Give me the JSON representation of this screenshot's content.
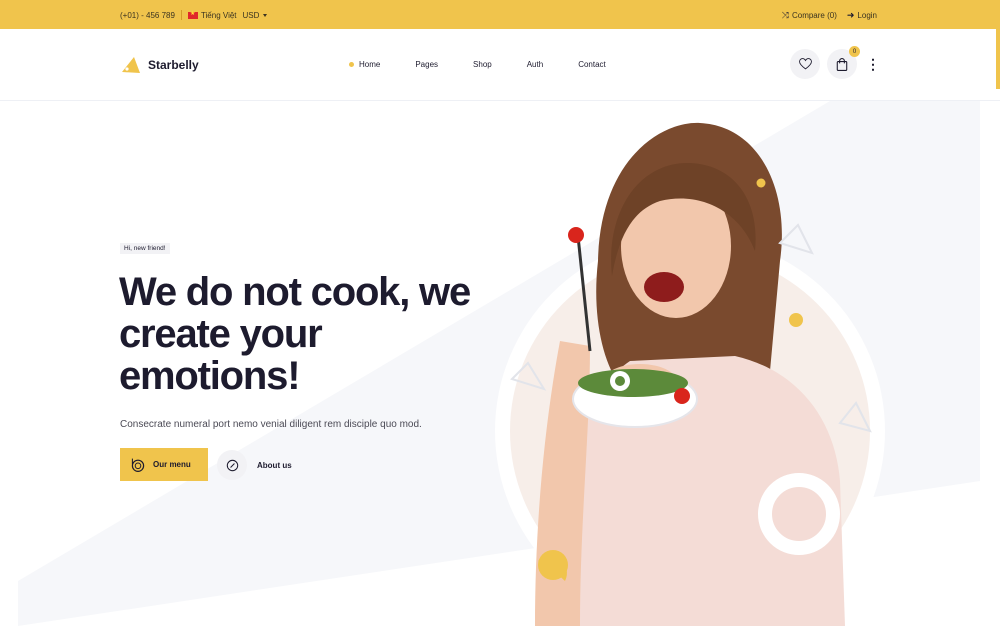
{
  "topbar": {
    "phone": "(+01) - 456 789",
    "language": "Tiếng Việt",
    "currency": "USD",
    "compare": "Compare (0)",
    "login": "Login"
  },
  "header": {
    "brand": "Starbelly",
    "nav": [
      {
        "label": "Home",
        "active": true
      },
      {
        "label": "Pages"
      },
      {
        "label": "Shop"
      },
      {
        "label": "Auth"
      },
      {
        "label": "Contact"
      }
    ],
    "cart_count": "0"
  },
  "hero": {
    "badge": "Hi, new friend!",
    "headline_line1": "We do not cook, we",
    "headline_line2": "create your",
    "headline_line3": "emotions!",
    "subtitle": "Consecrate numeral port nemo venial diligent rem disciple quo mod.",
    "menu_button": "Our menu",
    "about_link": "About us"
  },
  "colors": {
    "accent": "#f0c44c",
    "dark": "#1d1b2e",
    "light_bg": "#f6f7fa"
  }
}
